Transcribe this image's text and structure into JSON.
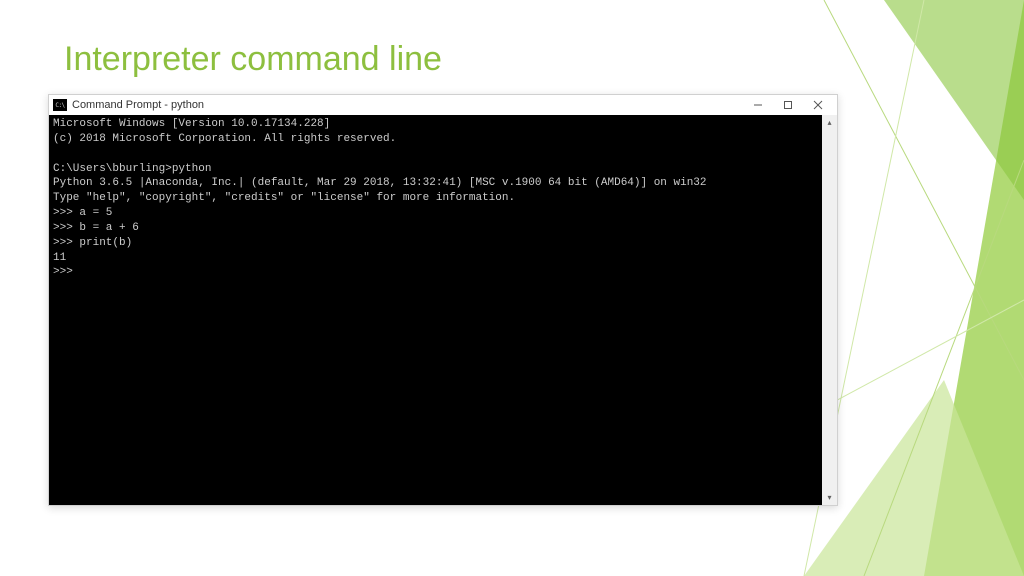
{
  "slide": {
    "title": "Interpreter command line"
  },
  "window": {
    "title": "Command Prompt - python"
  },
  "console": {
    "lines": [
      "Microsoft Windows [Version 10.0.17134.228]",
      "(c) 2018 Microsoft Corporation. All rights reserved.",
      "",
      "C:\\Users\\bburling>python",
      "Python 3.6.5 |Anaconda, Inc.| (default, Mar 29 2018, 13:32:41) [MSC v.1900 64 bit (AMD64)] on win32",
      "Type \"help\", \"copyright\", \"credits\" or \"license\" for more information.",
      ">>> a = 5",
      ">>> b = a + 6",
      ">>> print(b)",
      "11",
      ">>>"
    ]
  }
}
